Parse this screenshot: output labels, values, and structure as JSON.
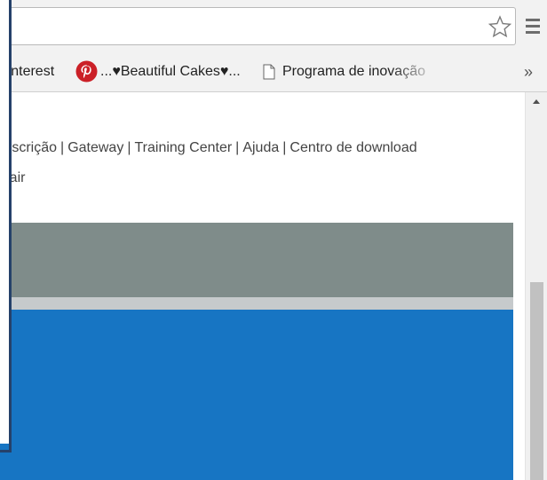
{
  "bookmarks": {
    "pinterest_label": "Pinterest",
    "cakes_label": "...♥Beautiful Cakes♥...",
    "programa_label": "Programa de inovação",
    "more_label": "»"
  },
  "page": {
    "nav_links": [
      "Inscrição",
      "Gateway",
      "Training Center",
      "Ajuda",
      "Centro de download"
    ],
    "separator": "|",
    "signout_label": "Sair"
  },
  "colors": {
    "gray_band": "#7f8c8a",
    "blue_band": "#1775c3",
    "pinterest_red": "#cb2027",
    "overlay_border": "#25416a"
  },
  "icons": [
    "star-icon",
    "chrome-menu-icon",
    "pinterest-icon",
    "document-icon",
    "scroll-up-arrow-icon"
  ]
}
